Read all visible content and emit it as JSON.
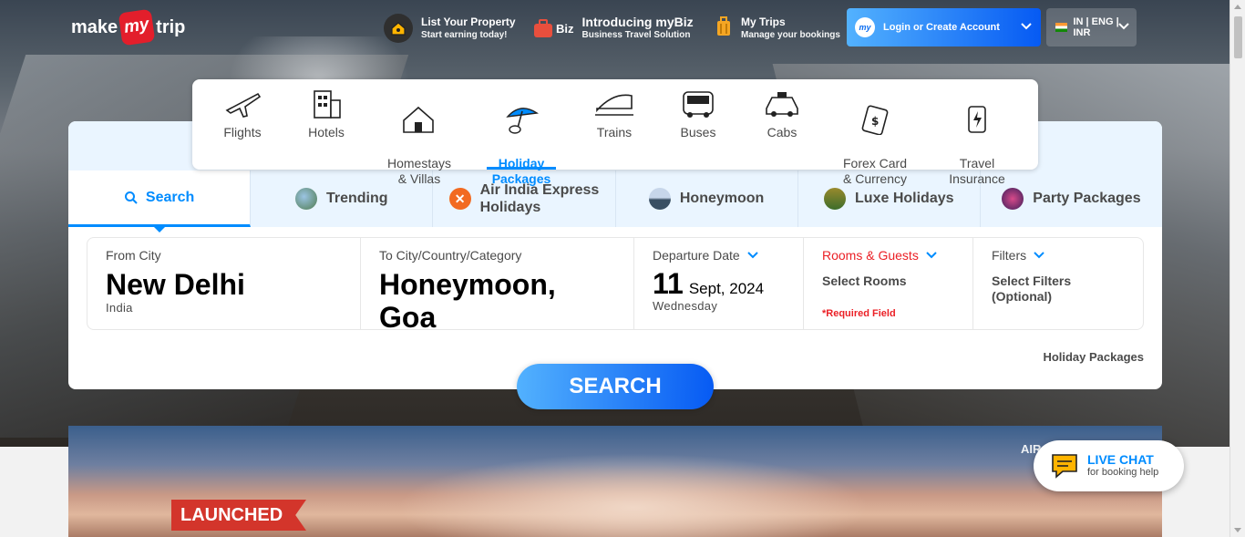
{
  "header": {
    "logo": {
      "left": "make",
      "mid": "my",
      "right": "trip"
    },
    "list_property": {
      "title": "List Your Property",
      "subtitle": "Start earning today!",
      "icon": "house-key-icon"
    },
    "mybiz": {
      "badge": "Biz",
      "title": "Introducing myBiz",
      "subtitle": "Business Travel Solution",
      "icon": "briefcase-icon"
    },
    "my_trips": {
      "title": "My Trips",
      "subtitle": "Manage your bookings",
      "icon": "suitcase-icon"
    },
    "login": {
      "label": "Login or Create Account",
      "avatar": "my"
    },
    "lang": {
      "label": "IN | ENG | INR"
    }
  },
  "nav": {
    "items": [
      {
        "label": "Flights",
        "icon": "flight-icon"
      },
      {
        "label": "Hotels",
        "icon": "hotel-icon"
      },
      {
        "label": "Homestays\n& Villas",
        "icon": "homestay-icon"
      },
      {
        "label": "Holiday\nPackages",
        "icon": "holiday-umbrella-icon",
        "active": true
      },
      {
        "label": "Trains",
        "icon": "train-icon"
      },
      {
        "label": "Buses",
        "icon": "bus-icon"
      },
      {
        "label": "Cabs",
        "icon": "cab-icon"
      },
      {
        "label": "Forex Card\n& Currency",
        "icon": "forex-card-icon"
      },
      {
        "label": "Travel\nInsurance",
        "icon": "insurance-icon"
      }
    ]
  },
  "tabs": [
    {
      "label": "Search",
      "active": true,
      "icon": "search-icon"
    },
    {
      "label": "Trending",
      "icon": "trending-thumb-icon"
    },
    {
      "label": "Air India Express\nHolidays",
      "icon": "air-india-express-icon"
    },
    {
      "label": "Honeymoon",
      "icon": "honeymoon-thumb-icon"
    },
    {
      "label": "Luxe Holidays",
      "icon": "luxe-thumb-icon"
    },
    {
      "label": "Party Packages",
      "icon": "party-thumb-icon"
    }
  ],
  "search_form": {
    "from": {
      "label": "From City",
      "value": "New Delhi",
      "sub": "India"
    },
    "to": {
      "label": "To City/Country/Category",
      "value": "Honeymoon, Goa"
    },
    "date": {
      "label": "Departure Date",
      "day": "11",
      "month_year": "Sept, 2024",
      "weekday": "Wednesday"
    },
    "rooms": {
      "label": "Rooms & Guests",
      "value": "Select Rooms",
      "required": "*Required Field"
    },
    "filters": {
      "label": "Filters",
      "value": "Select Filters\n(Optional)"
    },
    "footer_label": "Holiday Packages",
    "search_button": "SEARCH"
  },
  "banner": {
    "badge": "LAUNCHED",
    "brand_text": "AIR"
  },
  "live_chat": {
    "title": "LIVE CHAT",
    "subtitle": "for booking help",
    "icon": "chat-bubble-icon"
  },
  "colors": {
    "primary": "#008cff",
    "red": "#eb2026",
    "logo_red": "#e31e2b"
  }
}
